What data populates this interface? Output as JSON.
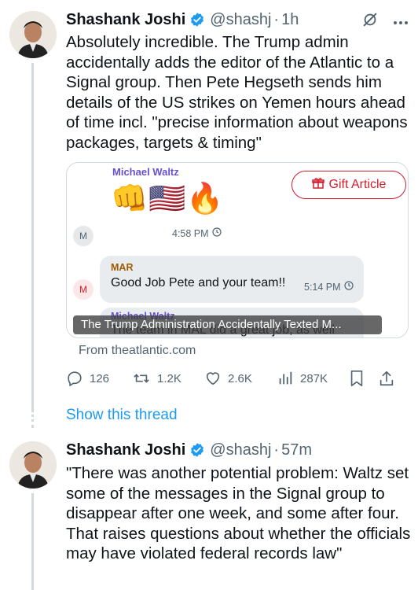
{
  "tweet1": {
    "name": "Shashank Joshi",
    "handle": "@shashj",
    "separator": "·",
    "time": "1h",
    "text": "Absolutely incredible. The Trump admin accidentally adds the editor of the Atlantic to a Signal group. Then Pete Hegseth sends him details of the US strikes on Yemen hours ahead of time incl. \"precise information about weapons packages, targets & timing\"",
    "card": {
      "sender_top": "Michael Waltz",
      "emojis": [
        "👊",
        "🇺🇸",
        "🔥"
      ],
      "gift_button": "Gift Article",
      "avatar_m1": "M",
      "time1": "4:58 PM",
      "sender2": "MAR",
      "message2": "Good Job Pete and your team!!",
      "time2": "5:14 PM",
      "avatar_m2": "M",
      "sender3": "Michael Waltz",
      "message3": "The team in MAL did a great job, as well",
      "overlay_title": "The Trump Administration Accidentally Texted M...",
      "source": "From theatlantic.com"
    },
    "stats": {
      "replies": "126",
      "reposts": "1.2K",
      "likes": "2.6K",
      "views": "287K"
    },
    "show_thread": "Show this thread"
  },
  "tweet2": {
    "name": "Shashank Joshi",
    "handle": "@shashj",
    "separator": "·",
    "time": "57m",
    "text": "\"There was another potential problem: Waltz set some of the messages in the Signal group to disappear after one week, and some after four. That raises questions about whether the officials may have violated federal records law\""
  },
  "colors": {
    "accent": "#1d9bf0",
    "gift_red": "#d31d2f",
    "secondary_text": "#536471"
  },
  "icons": [
    "verified-badge-icon",
    "grok-icon",
    "more-icon",
    "reply-icon",
    "repost-icon",
    "like-icon",
    "views-icon",
    "bookmark-icon",
    "share-icon",
    "gift-icon",
    "clock-icon"
  ]
}
